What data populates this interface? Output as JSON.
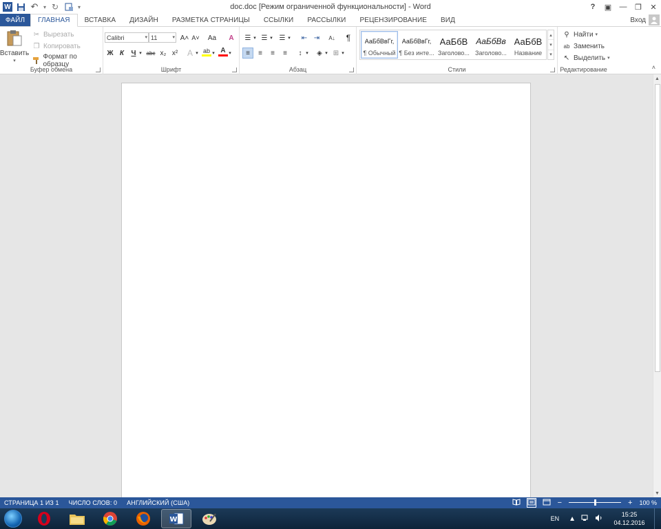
{
  "window": {
    "title": "doc.doc [Режим ограниченной функциональности] - Word",
    "help": "?",
    "ribbon_display": "▣",
    "minimize": "—",
    "restore": "❐",
    "close": "✕",
    "sign_in": "Вход"
  },
  "qat": {
    "app_icon": "W",
    "save_icon": "💾",
    "undo_icon": "↶",
    "undo_drop": "▾",
    "redo_icon": "↻",
    "touch_icon": "☐",
    "customize": "▾"
  },
  "tabs": [
    {
      "label": "ФАЙЛ"
    },
    {
      "label": "ГЛАВНАЯ"
    },
    {
      "label": "ВСТАВКА"
    },
    {
      "label": "ДИЗАЙН"
    },
    {
      "label": "РАЗМЕТКА СТРАНИЦЫ"
    },
    {
      "label": "ССЫЛКИ"
    },
    {
      "label": "РАССЫЛКИ"
    },
    {
      "label": "РЕЦЕНЗИРОВАНИЕ"
    },
    {
      "label": "ВИД"
    }
  ],
  "ribbon": {
    "clipboard": {
      "label": "Буфер обмена",
      "paste": "Вставить",
      "paste_drop": "▾",
      "cut": "Вырезать",
      "copy": "Копировать",
      "format_painter": "Формат по образцу"
    },
    "font": {
      "label": "Шрифт",
      "font_name": "Calibri",
      "font_size": "11",
      "grow": "A˄",
      "shrink": "A˅",
      "change_case": "Aa",
      "clear_format": "A",
      "bold": "Ж",
      "italic": "К",
      "underline": "Ч",
      "strike": "abc",
      "subscript": "x₂",
      "superscript": "x²",
      "effects": "A",
      "highlight": "ab",
      "font_color": "A"
    },
    "paragraph": {
      "label": "Абзац",
      "bullets": "☰",
      "numbering": "☰",
      "multilevel": "☰",
      "decrease_indent": "⇤",
      "increase_indent": "⇥",
      "sort": "A↓",
      "show_marks": "¶",
      "align_left": "≡",
      "align_center": "≡",
      "align_right": "≡",
      "justify": "≡",
      "line_spacing": "↕",
      "shading": "◈",
      "borders": "⊞"
    },
    "styles": {
      "label": "Стили",
      "items": [
        {
          "sample": "АаБбВвГг,",
          "name": "¶ Обычный"
        },
        {
          "sample": "АаБбВвГг,",
          "name": "¶ Без инте..."
        },
        {
          "sample": "АаБбВ",
          "name": "Заголово..."
        },
        {
          "sample": "АаБбВв",
          "name": "Заголово..."
        },
        {
          "sample": "АаБбВ",
          "name": "Название"
        }
      ],
      "scroll_up": "▴",
      "scroll_down": "▾",
      "more": "▾"
    },
    "editing": {
      "label": "Редактирование",
      "find": "Найти",
      "replace": "Заменить",
      "select": "Выделить"
    },
    "collapse_icon": "˄"
  },
  "status": {
    "page": "СТРАНИЦА 1 ИЗ 1",
    "words": "ЧИСЛО СЛОВ: 0",
    "language": "АНГЛИЙСКИЙ (США)",
    "zoom_minus": "−",
    "zoom_plus": "+",
    "zoom": "100 %",
    "zoom_level_percent": 100
  },
  "taskbar": {
    "language": "EN",
    "time": "15:25",
    "date": "04.12.2016"
  },
  "colors": {
    "accent": "#2b579a",
    "highlight_bar": "#ffff00",
    "font_color_bar": "#ff0000"
  }
}
